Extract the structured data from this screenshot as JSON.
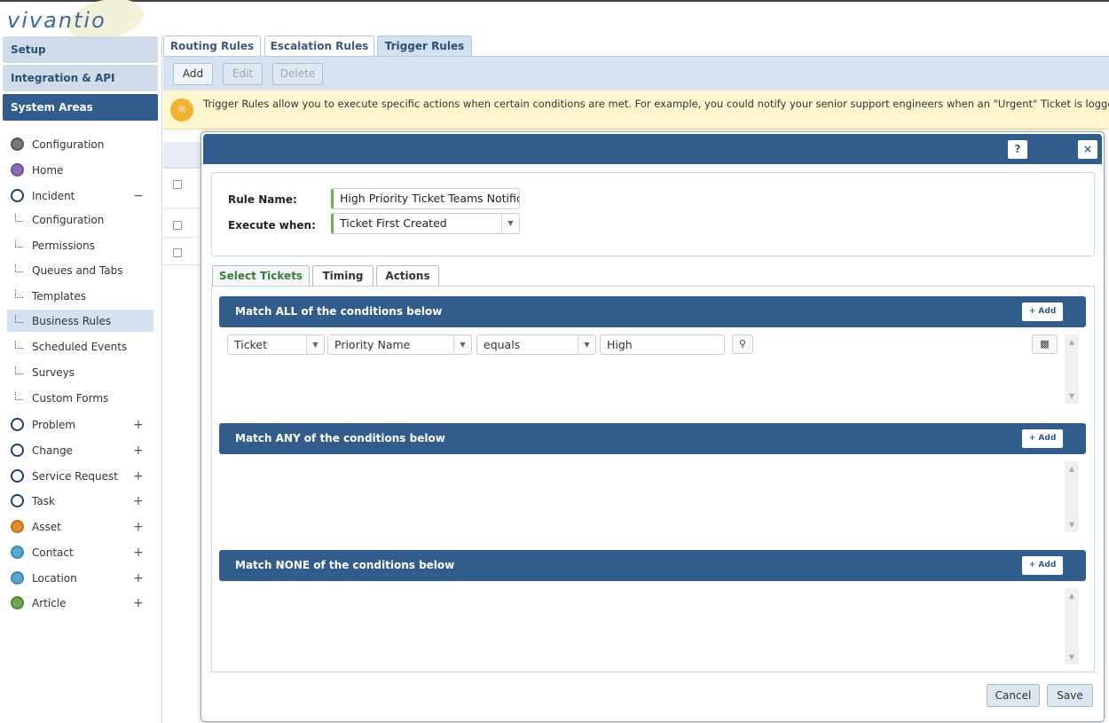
{
  "app": {
    "logo_text": "vivantio"
  },
  "sidebar": {
    "headers": [
      {
        "label": "Setup"
      },
      {
        "label": "Integration & API"
      },
      {
        "label": "System Areas"
      }
    ],
    "items": [
      {
        "label": "Configuration",
        "icon": "gear-icon"
      },
      {
        "label": "Home",
        "icon": "home-icon"
      },
      {
        "label": "Incident",
        "icon": "incident-icon",
        "toggle": "−"
      },
      {
        "label": "Configuration",
        "icon": "tree-branch-icon"
      },
      {
        "label": "Permissions",
        "icon": "tree-branch-icon"
      },
      {
        "label": "Queues and Tabs",
        "icon": "tree-branch-icon"
      },
      {
        "label": "Templates",
        "icon": "tree-branch-icon"
      },
      {
        "label": "Business Rules",
        "icon": "tree-branch-icon"
      },
      {
        "label": "Scheduled Events",
        "icon": "tree-branch-icon"
      },
      {
        "label": "Surveys",
        "icon": "tree-branch-icon"
      },
      {
        "label": "Custom Forms",
        "icon": "tree-branch-icon"
      },
      {
        "label": "Problem",
        "icon": "problem-icon",
        "toggle": "+"
      },
      {
        "label": "Change",
        "icon": "change-icon",
        "toggle": "+"
      },
      {
        "label": "Service Request",
        "icon": "service-request-icon",
        "toggle": "+"
      },
      {
        "label": "Task",
        "icon": "task-icon",
        "toggle": "+"
      },
      {
        "label": "Asset",
        "icon": "asset-icon",
        "toggle": "+"
      },
      {
        "label": "Contact",
        "icon": "contact-icon",
        "toggle": "+"
      },
      {
        "label": "Location",
        "icon": "location-icon",
        "toggle": "+"
      },
      {
        "label": "Article",
        "icon": "article-icon",
        "toggle": "+"
      }
    ]
  },
  "tabs": [
    {
      "label": "Routing Rules"
    },
    {
      "label": "Escalation Rules"
    },
    {
      "label": "Trigger Rules"
    }
  ],
  "toolbar": {
    "add": "Add",
    "edit": "Edit",
    "delete": "Delete"
  },
  "info": {
    "icon": "lightbulb-icon",
    "text": "Trigger Rules allow you to execute specific actions when certain conditions are met. For example, you could notify your senior support engineers when an \"Urgent\" Ticket is logged"
  },
  "dialog": {
    "help": "?",
    "close": "×",
    "rule_name_label": "Rule Name:",
    "rule_name_value": "High Priority Ticket Teams Notifica",
    "execute_when_label": "Execute when:",
    "execute_when_value": "Ticket First Created",
    "tabs": [
      {
        "label": "Select Tickets"
      },
      {
        "label": "Timing"
      },
      {
        "label": "Actions"
      }
    ],
    "sections": [
      {
        "title": "Match ALL of the conditions below",
        "add": "+ Add"
      },
      {
        "title": "Match ANY of the conditions below",
        "add": "+ Add"
      },
      {
        "title": "Match NONE of the conditions below",
        "add": "+ Add"
      }
    ],
    "condition": {
      "entity": "Ticket",
      "field": "Priority Name",
      "operator": "equals",
      "value": "High"
    },
    "cancel": "Cancel",
    "save": "Save"
  },
  "colors": {
    "primary": "#325c8c",
    "accent_green": "#6ab150",
    "info_bg": "#fdf6cf"
  }
}
